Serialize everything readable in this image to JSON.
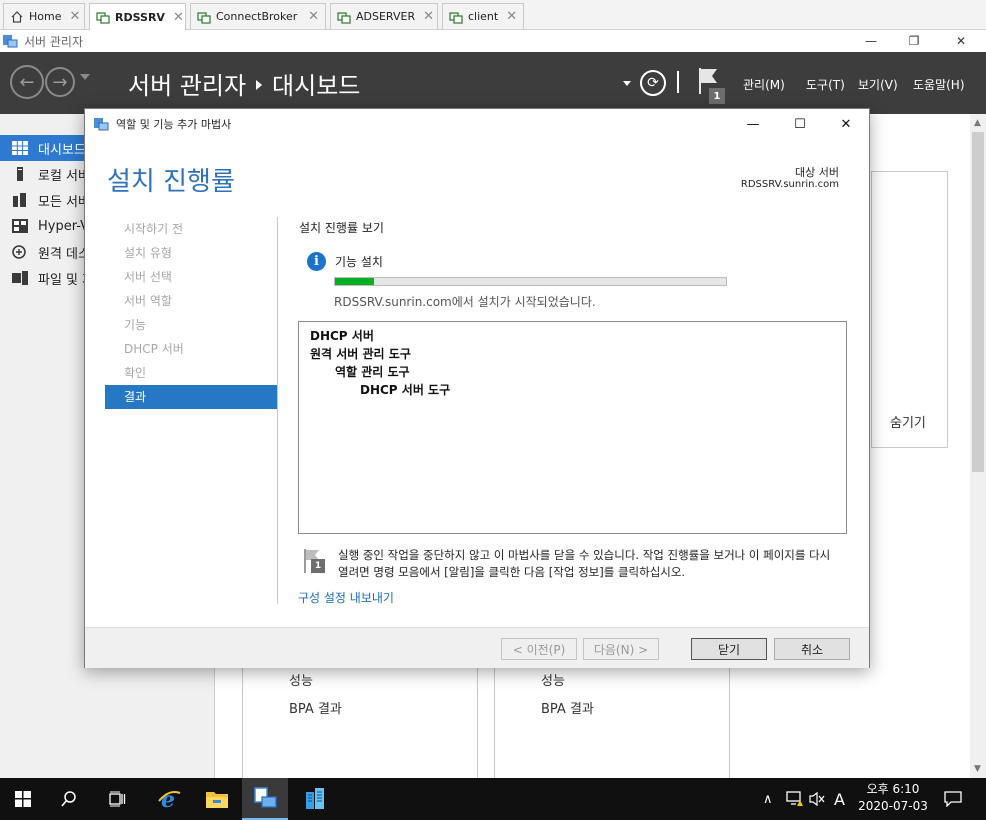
{
  "rdp_tabs": [
    {
      "label": "Home"
    },
    {
      "label": "RDSSRV"
    },
    {
      "label": "ConnectBroker"
    },
    {
      "label": "ADSERVER"
    },
    {
      "label": "client"
    }
  ],
  "host_window": {
    "title": "서버 관리자"
  },
  "header": {
    "app": "서버 관리자",
    "page": "대시보드",
    "notification_count": "1",
    "menus": [
      "관리(M)",
      "도구(T)",
      "보기(V)",
      "도움말(H)"
    ]
  },
  "nav": {
    "items": [
      {
        "label": "대시보드",
        "icon": "dashboard-icon"
      },
      {
        "label": "로컬 서버",
        "icon": "server-icon"
      },
      {
        "label": "모든 서버",
        "icon": "servers-icon"
      },
      {
        "label": "Hyper-V",
        "icon": "hyperv-icon"
      },
      {
        "label": "원격 데스크톱 서비스",
        "icon": "remote-desktop-icon"
      },
      {
        "label": "파일 및 저장소 서비스",
        "icon": "file-storage-icon"
      }
    ]
  },
  "dashboard": {
    "hide_label": "숨기기",
    "card1": {
      "perf": "성능",
      "bpa": "BPA 결과"
    },
    "card2": {
      "perf": "성능",
      "bpa": "BPA 결과"
    }
  },
  "wizard": {
    "title": "역할 및 기능 추가 마법사",
    "heading": "설치 진행률",
    "dest_label": "대상 서버",
    "dest_value": "RDSSRV.sunrin.com",
    "steps": [
      "시작하기 전",
      "설치 유형",
      "서버 선택",
      "서버 역할",
      "기능",
      "DHCP 서버",
      "확인",
      "결과"
    ],
    "selected_step": "결과",
    "section_heading": "설치 진행률 보기",
    "feature_install": "기능 설치",
    "progress_fraction": 0.1,
    "status": "RDSSRV.sunrin.com에서 설치가 시작되었습니다.",
    "results": [
      "DHCP 서버",
      "원격 서버 관리 도구",
      "역할 관리 도구",
      "DHCP 서버 도구"
    ],
    "note": "실행 중인 작업을 중단하지 않고 이 마법사를 닫을 수 있습니다. 작업 진행률을 보거나 이 페이지를 다시 열려면 명령 모음에서 [알림]을 클릭한 다음 [작업 정보]를 클릭하십시오.",
    "note_badge": "1",
    "export_link": "구성 설정 내보내기",
    "buttons": {
      "prev": "< 이전(P)",
      "next": "다음(N) >",
      "close": "닫기",
      "cancel": "취소"
    }
  },
  "taskbar": {
    "ime": "A",
    "time": "오후 6:10",
    "date": "2020-07-03"
  },
  "colors": {
    "header_bg": "#3d3d3d",
    "accent": "#2677c4",
    "progress": "#06b025",
    "link": "#1c6bbf"
  }
}
